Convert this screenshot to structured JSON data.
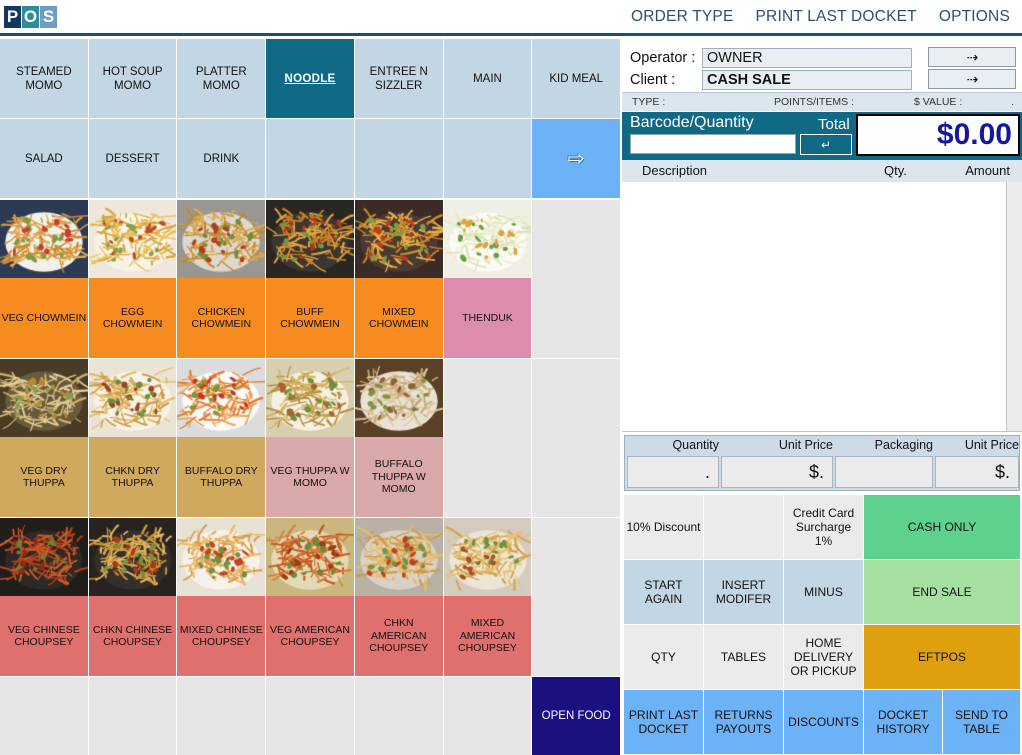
{
  "app": {
    "logo": [
      "P",
      "O",
      "S"
    ]
  },
  "topnav": [
    {
      "label": "ORDER TYPE",
      "name": "order-type"
    },
    {
      "label": "PRINT LAST DOCKET",
      "name": "print-last-docket"
    },
    {
      "label": "OPTIONS",
      "name": "options"
    }
  ],
  "categories": {
    "row1": [
      {
        "label": "STEAMED MOMO",
        "state": "normal"
      },
      {
        "label": "HOT SOUP MOMO",
        "state": "normal"
      },
      {
        "label": "PLATTER MOMO",
        "state": "normal"
      },
      {
        "label": "NOODLE",
        "state": "selected"
      },
      {
        "label": "ENTREE N SIZZLER",
        "state": "normal"
      },
      {
        "label": "MAIN",
        "state": "normal"
      },
      {
        "label": "KID MEAL",
        "state": "normal"
      }
    ],
    "row2": [
      {
        "label": "SALAD",
        "state": "normal"
      },
      {
        "label": "DESSERT",
        "state": "normal"
      },
      {
        "label": "DRINK",
        "state": "normal"
      },
      {
        "label": "",
        "state": "empty"
      },
      {
        "label": "",
        "state": "empty"
      },
      {
        "label": "",
        "state": "empty"
      },
      {
        "label": "",
        "state": "arrow",
        "icon": "next-page-arrow-icon"
      }
    ]
  },
  "products": {
    "row1": [
      {
        "label": "VEG CHOWMEIN",
        "color": "#f68b1f",
        "photo": "noodle-plate"
      },
      {
        "label": "EGG CHOWMEIN",
        "color": "#f68b1f",
        "photo": "noodle-egg"
      },
      {
        "label": "CHICKEN CHOWMEIN",
        "color": "#f68b1f",
        "photo": "noodle-chicken"
      },
      {
        "label": "BUFF CHOWMEIN",
        "color": "#f68b1f",
        "photo": "noodle-buff"
      },
      {
        "label": "MIXED CHOWMEIN",
        "color": "#f68b1f",
        "photo": "noodle-mixed"
      },
      {
        "label": "THENDUK",
        "color": "#dd8cad",
        "photo": "soup-bowl"
      },
      {
        "label": "",
        "color": "#e6e6e6",
        "photo": ""
      }
    ],
    "row2": [
      {
        "label": "VEG DRY THUPPA",
        "color": "#cfa95e",
        "photo": "thuppa-veg"
      },
      {
        "label": "CHKN DRY THUPPA",
        "color": "#cfa95e",
        "photo": "thuppa-chkn"
      },
      {
        "label": "BUFFALO DRY THUPPA",
        "color": "#cfa95e",
        "photo": "thuppa-buffalo"
      },
      {
        "label": "VEG THUPPA W MOMO",
        "color": "#d9a8a8",
        "photo": "thuppa-momo-soup"
      },
      {
        "label": "BUFFALO THUPPA W MOMO",
        "color": "#d9a8a8",
        "photo": "momo-bowl"
      },
      {
        "label": "",
        "color": "#e6e6e6",
        "photo": ""
      },
      {
        "label": "",
        "color": "#e6e6e6",
        "photo": ""
      }
    ],
    "row3": [
      {
        "label": "VEG CHINESE CHOUPSEY",
        "color": "#e0706e",
        "photo": "choupsey-veg"
      },
      {
        "label": "CHKN CHINESE CHOUPSEY",
        "color": "#e0706e",
        "photo": "choupsey-chkn"
      },
      {
        "label": "MIXED CHINESE CHOUPSEY",
        "color": "#e0706e",
        "photo": "choupsey-mixed"
      },
      {
        "label": "VEG AMERICAN CHOUPSEY",
        "color": "#e0706e",
        "photo": "choupsey-amer-veg"
      },
      {
        "label": "CHKN AMERICAN CHOUPSEY",
        "color": "#e0706e",
        "photo": "choupsey-amer-chkn"
      },
      {
        "label": "MIXED AMERICAN CHOUPSEY",
        "color": "#e0706e",
        "photo": "choupsey-amer-mixed"
      },
      {
        "label": "",
        "color": "#e6e6e6",
        "photo": ""
      }
    ],
    "row4": [
      {
        "label": "",
        "color": "#e6e6e6",
        "photo": ""
      },
      {
        "label": "",
        "color": "#e6e6e6",
        "photo": ""
      },
      {
        "label": "",
        "color": "#e6e6e6",
        "photo": ""
      },
      {
        "label": "",
        "color": "#e6e6e6",
        "photo": ""
      },
      {
        "label": "",
        "color": "#e6e6e6",
        "photo": ""
      },
      {
        "label": "",
        "color": "#e6e6e6",
        "photo": ""
      },
      {
        "label": "OPEN FOOD",
        "color": "#1b1080",
        "photo": "",
        "text_color": "#ffffff"
      }
    ]
  },
  "sale": {
    "operator_label": "Operator :",
    "operator_value": "OWNER",
    "client_label": "Client :",
    "client_value": "CASH SALE",
    "operator_arrow_icon": "dashed-arrow-right-icon",
    "client_arrow_icon": "dashed-arrow-right-icon",
    "type_label": "TYPE :",
    "points_label": "POINTS/ITEMS :",
    "points_value": ".",
    "value_label": "$ VALUE :",
    "value_value": ".",
    "barcode_label": "Barcode/Quantity",
    "barcode_value": "",
    "barcode_placeholder": "",
    "enter_icon": "enter-key-icon",
    "total_label": "Total",
    "total_value": "$0.00",
    "col_description": "Description",
    "col_qty": "Qty.",
    "col_amount": "Amount",
    "line_items": []
  },
  "detail": {
    "quantity_label": "Quantity",
    "quantity_value": ".",
    "unit_price_label": "Unit Price",
    "unit_price_value": "$.",
    "packaging_label": "Packaging",
    "packaging_value": "",
    "packaging_unit_price_label": "Unit Price",
    "packaging_unit_price_value": "$."
  },
  "actions": {
    "row1": [
      {
        "label": "10% Discount",
        "style": "a-grey"
      },
      {
        "label": "",
        "style": "a-grey"
      },
      {
        "label": "Credit Card Surcharge 1%",
        "style": "a-grey"
      },
      {
        "label": "CASH ONLY",
        "style": "a-green"
      }
    ],
    "row2": [
      {
        "label": "START AGAIN",
        "style": "a-blue"
      },
      {
        "label": "INSERT MODIFER",
        "style": "a-blue"
      },
      {
        "label": "MINUS",
        "style": "a-blue"
      },
      {
        "label": "END SALE",
        "style": "a-lgreen"
      }
    ],
    "row3": [
      {
        "label": "QTY",
        "style": "a-grey"
      },
      {
        "label": "TABLES",
        "style": "a-grey"
      },
      {
        "label": "HOME DELIVERY OR PICKUP",
        "style": "a-grey"
      },
      {
        "label": "EFTPOS",
        "style": "a-orange"
      }
    ],
    "row4": [
      {
        "label": "PRINT LAST DOCKET",
        "style": "a-skyblue"
      },
      {
        "label": "RETURNS PAYOUTS",
        "style": "a-skyblue"
      },
      {
        "label": "DISCOUNTS",
        "style": "a-skyblue"
      },
      {
        "label": "DOCKET HISTORY",
        "style": "a-skyblue"
      },
      {
        "label": "SEND TO TABLE",
        "style": "a-skyblue"
      }
    ]
  },
  "colors": {
    "accent_teal": "#116a85",
    "header_blue": "#1b4f7a",
    "category_blue": "#c3d6e4",
    "total_text": "#16189c"
  }
}
